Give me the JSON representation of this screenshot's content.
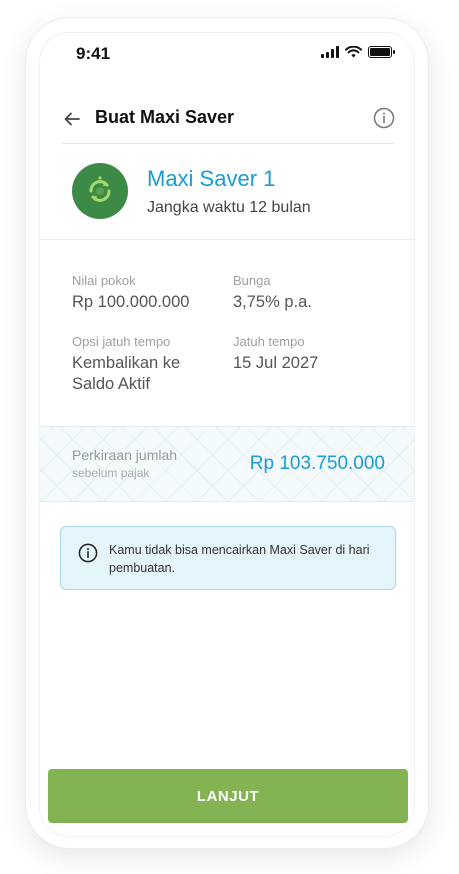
{
  "status_bar": {
    "time": "9:41"
  },
  "header": {
    "title": "Buat Maxi Saver"
  },
  "product": {
    "name": "Maxi Saver 1",
    "term": "Jangka waktu 12 bulan"
  },
  "details": {
    "principal_label": "Nilai pokok",
    "principal_value": "Rp 100.000.000",
    "interest_label": "Bunga",
    "interest_value": "3,75% p.a.",
    "maturity_option_label": "Opsi jatuh tempo",
    "maturity_option_value_line1": "Kembalikan ke",
    "maturity_option_value_line2": "Saldo Aktif",
    "maturity_date_label": "Jatuh tempo",
    "maturity_date_value": "15 Jul 2027"
  },
  "estimate": {
    "label_line1": "Perkiraan jumlah",
    "label_line2": "sebelum pajak",
    "value": "Rp 103.750.000"
  },
  "notice": {
    "text": "Kamu tidak bisa mencairkan Maxi Saver di hari pembuatan."
  },
  "footer": {
    "button_label": "LANJUT"
  },
  "colors": {
    "accent_blue": "#1a9bd1",
    "button_green": "#84b354",
    "avatar_green": "#3c8a45",
    "notice_bg": "#e3f4fb"
  },
  "icons": {
    "back": "arrow-left-icon",
    "info": "info-icon",
    "product": "saver-cycle-icon"
  }
}
